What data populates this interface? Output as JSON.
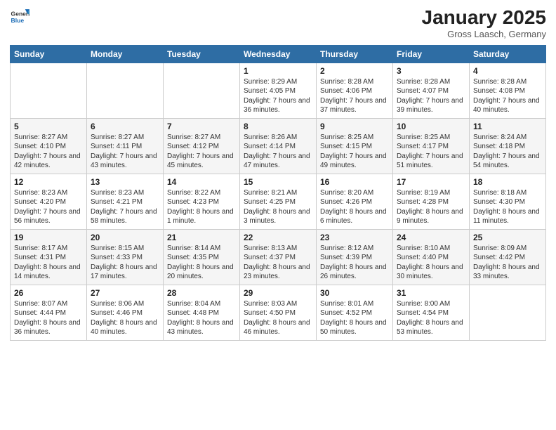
{
  "header": {
    "logo_general": "General",
    "logo_blue": "Blue",
    "month_title": "January 2025",
    "subtitle": "Gross Laasch, Germany"
  },
  "days_of_week": [
    "Sunday",
    "Monday",
    "Tuesday",
    "Wednesday",
    "Thursday",
    "Friday",
    "Saturday"
  ],
  "weeks": [
    [
      {
        "day": null,
        "info": ""
      },
      {
        "day": null,
        "info": ""
      },
      {
        "day": null,
        "info": ""
      },
      {
        "day": "1",
        "info": "Sunrise: 8:29 AM\nSunset: 4:05 PM\nDaylight: 7 hours and 36 minutes."
      },
      {
        "day": "2",
        "info": "Sunrise: 8:28 AM\nSunset: 4:06 PM\nDaylight: 7 hours and 37 minutes."
      },
      {
        "day": "3",
        "info": "Sunrise: 8:28 AM\nSunset: 4:07 PM\nDaylight: 7 hours and 39 minutes."
      },
      {
        "day": "4",
        "info": "Sunrise: 8:28 AM\nSunset: 4:08 PM\nDaylight: 7 hours and 40 minutes."
      }
    ],
    [
      {
        "day": "5",
        "info": "Sunrise: 8:27 AM\nSunset: 4:10 PM\nDaylight: 7 hours and 42 minutes."
      },
      {
        "day": "6",
        "info": "Sunrise: 8:27 AM\nSunset: 4:11 PM\nDaylight: 7 hours and 43 minutes."
      },
      {
        "day": "7",
        "info": "Sunrise: 8:27 AM\nSunset: 4:12 PM\nDaylight: 7 hours and 45 minutes."
      },
      {
        "day": "8",
        "info": "Sunrise: 8:26 AM\nSunset: 4:14 PM\nDaylight: 7 hours and 47 minutes."
      },
      {
        "day": "9",
        "info": "Sunrise: 8:25 AM\nSunset: 4:15 PM\nDaylight: 7 hours and 49 minutes."
      },
      {
        "day": "10",
        "info": "Sunrise: 8:25 AM\nSunset: 4:17 PM\nDaylight: 7 hours and 51 minutes."
      },
      {
        "day": "11",
        "info": "Sunrise: 8:24 AM\nSunset: 4:18 PM\nDaylight: 7 hours and 54 minutes."
      }
    ],
    [
      {
        "day": "12",
        "info": "Sunrise: 8:23 AM\nSunset: 4:20 PM\nDaylight: 7 hours and 56 minutes."
      },
      {
        "day": "13",
        "info": "Sunrise: 8:23 AM\nSunset: 4:21 PM\nDaylight: 7 hours and 58 minutes."
      },
      {
        "day": "14",
        "info": "Sunrise: 8:22 AM\nSunset: 4:23 PM\nDaylight: 8 hours and 1 minute."
      },
      {
        "day": "15",
        "info": "Sunrise: 8:21 AM\nSunset: 4:25 PM\nDaylight: 8 hours and 3 minutes."
      },
      {
        "day": "16",
        "info": "Sunrise: 8:20 AM\nSunset: 4:26 PM\nDaylight: 8 hours and 6 minutes."
      },
      {
        "day": "17",
        "info": "Sunrise: 8:19 AM\nSunset: 4:28 PM\nDaylight: 8 hours and 9 minutes."
      },
      {
        "day": "18",
        "info": "Sunrise: 8:18 AM\nSunset: 4:30 PM\nDaylight: 8 hours and 11 minutes."
      }
    ],
    [
      {
        "day": "19",
        "info": "Sunrise: 8:17 AM\nSunset: 4:31 PM\nDaylight: 8 hours and 14 minutes."
      },
      {
        "day": "20",
        "info": "Sunrise: 8:15 AM\nSunset: 4:33 PM\nDaylight: 8 hours and 17 minutes."
      },
      {
        "day": "21",
        "info": "Sunrise: 8:14 AM\nSunset: 4:35 PM\nDaylight: 8 hours and 20 minutes."
      },
      {
        "day": "22",
        "info": "Sunrise: 8:13 AM\nSunset: 4:37 PM\nDaylight: 8 hours and 23 minutes."
      },
      {
        "day": "23",
        "info": "Sunrise: 8:12 AM\nSunset: 4:39 PM\nDaylight: 8 hours and 26 minutes."
      },
      {
        "day": "24",
        "info": "Sunrise: 8:10 AM\nSunset: 4:40 PM\nDaylight: 8 hours and 30 minutes."
      },
      {
        "day": "25",
        "info": "Sunrise: 8:09 AM\nSunset: 4:42 PM\nDaylight: 8 hours and 33 minutes."
      }
    ],
    [
      {
        "day": "26",
        "info": "Sunrise: 8:07 AM\nSunset: 4:44 PM\nDaylight: 8 hours and 36 minutes."
      },
      {
        "day": "27",
        "info": "Sunrise: 8:06 AM\nSunset: 4:46 PM\nDaylight: 8 hours and 40 minutes."
      },
      {
        "day": "28",
        "info": "Sunrise: 8:04 AM\nSunset: 4:48 PM\nDaylight: 8 hours and 43 minutes."
      },
      {
        "day": "29",
        "info": "Sunrise: 8:03 AM\nSunset: 4:50 PM\nDaylight: 8 hours and 46 minutes."
      },
      {
        "day": "30",
        "info": "Sunrise: 8:01 AM\nSunset: 4:52 PM\nDaylight: 8 hours and 50 minutes."
      },
      {
        "day": "31",
        "info": "Sunrise: 8:00 AM\nSunset: 4:54 PM\nDaylight: 8 hours and 53 minutes."
      },
      {
        "day": null,
        "info": ""
      }
    ]
  ]
}
